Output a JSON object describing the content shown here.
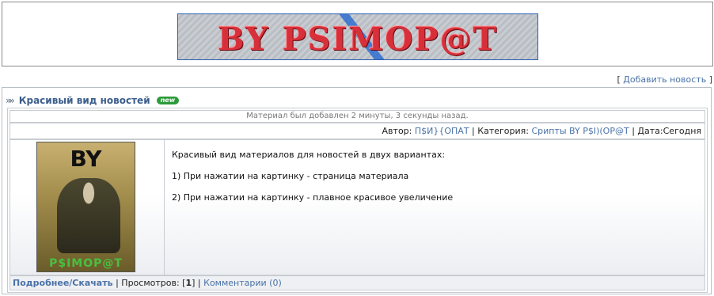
{
  "banner": {
    "text": "BY PSIMOP@T"
  },
  "add_news": {
    "open": "[",
    "label": "Добавить новость",
    "close": "]"
  },
  "news": {
    "title": "Красивый вид новостей",
    "badge": "new",
    "added_info": "Материал был добавлен 2 минуты, 3 секунды назад.",
    "meta": {
      "author_label": "Автор:",
      "author": "П$И}{ОПАТ",
      "category_label": "Категория:",
      "category": "Срипты BY P$I)(OP@T",
      "date_label": "Дата:",
      "date": "Сегодня"
    },
    "image": {
      "top_text": "BY",
      "bottom_text": "P$IMOP@T"
    },
    "paragraphs": [
      "Красивый вид материалов для новостей в двух вариантах:",
      "1) При нажатии на картинку - страница материала",
      "2) При нажатии на картинку - плавное красивое увеличение"
    ],
    "footer": {
      "more_label": "Подробнее/Скачать",
      "views_label": "Просмотров:",
      "views": "1",
      "comments_label": "Комментарии (0)"
    }
  }
}
